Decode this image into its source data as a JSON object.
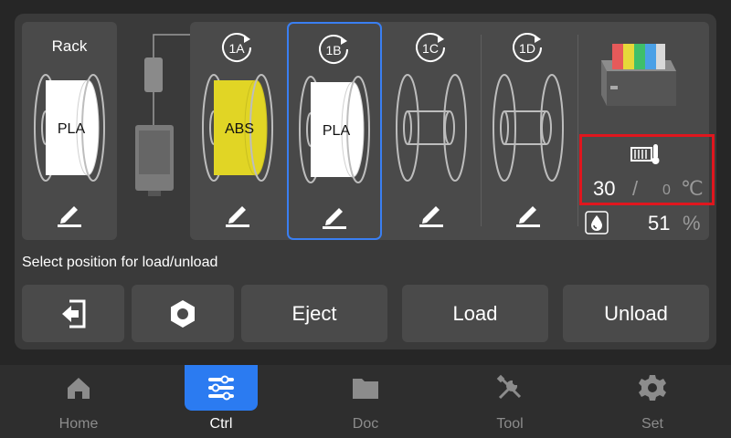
{
  "rack": {
    "title": "Rack",
    "spool": {
      "material": "PLA",
      "color": "#ffffff"
    }
  },
  "slots": [
    {
      "id": "1A",
      "material": "ABS",
      "color": "#e1d525",
      "selected": false
    },
    {
      "id": "1B",
      "material": "PLA",
      "color": "#ffffff",
      "selected": true
    },
    {
      "id": "1C",
      "material": "",
      "color": "",
      "selected": false
    },
    {
      "id": "1D",
      "material": "",
      "color": "",
      "selected": false
    }
  ],
  "climate": {
    "temperature": "30",
    "separator": "/",
    "target_temperature": "0",
    "temperature_unit": "℃",
    "humidity": "51",
    "humidity_unit": "%"
  },
  "prompt": "Select position for load/unload",
  "actions": {
    "eject": "Eject",
    "load": "Load",
    "unload": "Unload"
  },
  "nav": [
    {
      "label": "Home",
      "icon": "home-icon",
      "active": false
    },
    {
      "label": "Ctrl",
      "icon": "sliders-icon",
      "active": true
    },
    {
      "label": "Doc",
      "icon": "folder-icon",
      "active": false
    },
    {
      "label": "Tool",
      "icon": "tools-icon",
      "active": false
    },
    {
      "label": "Set",
      "icon": "gear-icon",
      "active": false
    }
  ],
  "colors": {
    "accent": "#2b7bf1",
    "highlight_border": "#e0161e",
    "panel": "#3a3a3a",
    "card": "#4a4a4a"
  }
}
